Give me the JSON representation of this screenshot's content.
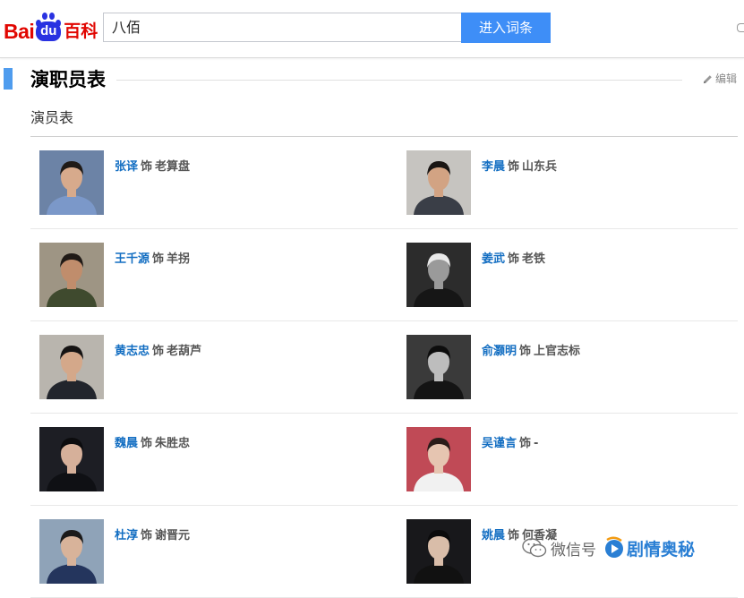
{
  "header": {
    "logo": {
      "bai": "Bai",
      "du": "du",
      "baike": "百科"
    },
    "search": {
      "value": "八佰",
      "button_label": "进入词条"
    }
  },
  "section": {
    "title": "演职员表",
    "edit_label": "编辑",
    "subtitle": "演员表",
    "as_word": "饰"
  },
  "cast": [
    {
      "actor": "张译",
      "role": "老算盘",
      "photo": {
        "bg": "#6c83a6",
        "suit": "#7b98c9",
        "skin": "#d7aa8c",
        "hair": "#1f1a17"
      }
    },
    {
      "actor": "李晨",
      "role": "山东兵",
      "photo": {
        "bg": "#c6c4c0",
        "suit": "#3a3e47",
        "skin": "#d2a383",
        "hair": "#1a1614"
      }
    },
    {
      "actor": "王千源",
      "role": "羊拐",
      "photo": {
        "bg": "#9e9584",
        "suit": "#3f4a2e",
        "skin": "#c08d6c",
        "hair": "#201a16"
      }
    },
    {
      "actor": "姜武",
      "role": "老铁",
      "photo": {
        "bg": "#2c2c2c",
        "suit": "#161616",
        "skin": "#9a9a9a",
        "hair": "#e9e9e9"
      }
    },
    {
      "actor": "黄志忠",
      "role": "老葫芦",
      "photo": {
        "bg": "#b9b5ae",
        "suit": "#22252c",
        "skin": "#d4a88a",
        "hair": "#151313"
      }
    },
    {
      "actor": "俞灏明",
      "role": "上官志标",
      "photo": {
        "bg": "#3a3a3a",
        "suit": "#141414",
        "skin": "#bdbdbd",
        "hair": "#0d0d0d"
      }
    },
    {
      "actor": "魏晨",
      "role": "朱胜忠",
      "photo": {
        "bg": "#1d1e24",
        "suit": "#0f1014",
        "skin": "#d6b09a",
        "hair": "#0c0c0e"
      }
    },
    {
      "actor": "吴谨言",
      "role": "-",
      "photo": {
        "bg": "#c04a56",
        "suit": "#f1f1f1",
        "skin": "#e6c5b1",
        "hair": "#2b1d1a"
      }
    },
    {
      "actor": "杜淳",
      "role": "谢晋元",
      "photo": {
        "bg": "#8fa3b8",
        "suit": "#24355d",
        "skin": "#d8b39a",
        "hair": "#1b1a1a"
      }
    },
    {
      "actor": "姚晨",
      "role": "何香凝",
      "photo": {
        "bg": "#18181b",
        "suit": "#111",
        "skin": "#d9bda9",
        "hair": "#0b0b0c"
      }
    }
  ],
  "watermark": {
    "wechat": "微信号",
    "name": "剧情奥秘"
  },
  "colors": {
    "accent": "#3e8ef7",
    "title_bar": "#4f9cee",
    "link": "#136ec2",
    "brand_red": "#e10601",
    "brand_blue": "#2932e1"
  }
}
